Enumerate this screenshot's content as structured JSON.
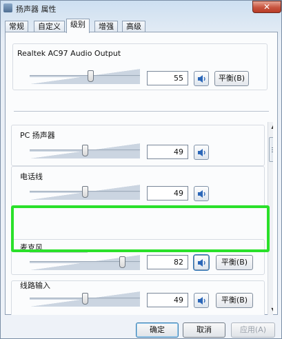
{
  "window": {
    "title": "扬声器 属性",
    "close_glyph": "✕"
  },
  "tabs": [
    {
      "label": "常规"
    },
    {
      "label": "自定义"
    },
    {
      "label": "级别",
      "active": true
    },
    {
      "label": "增强"
    },
    {
      "label": "高级"
    }
  ],
  "master": {
    "device_name": "Realtek AC97 Audio Output",
    "level": 55,
    "balance_label": "平衡(B)"
  },
  "channels": [
    {
      "name": "PC 扬声器",
      "level": 49
    },
    {
      "name": "电话线",
      "level": 49
    },
    {
      "name": "麦克风",
      "level": 82,
      "balance_label": "平衡(B)"
    },
    {
      "name": "线路输入",
      "level": 49,
      "balance_label": "平衡(B)"
    }
  ],
  "buttons": {
    "ok": "确定",
    "cancel": "取消",
    "apply": "应用(A)"
  },
  "icons": {
    "speaker": "speaker-icon",
    "close": "close-icon",
    "scroll_up": "▲",
    "scroll_down": "▼"
  },
  "colors": {
    "highlight": "#2ae02a",
    "window_bg": "#dbe6f2"
  }
}
